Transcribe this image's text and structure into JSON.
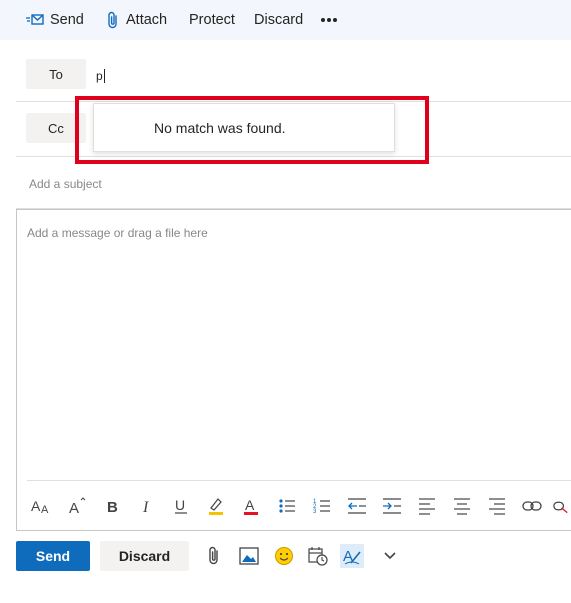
{
  "toolbar": {
    "send_label": "Send",
    "attach_label": "Attach",
    "protect_label": "Protect",
    "discard_label": "Discard",
    "more_icon": "more-icon"
  },
  "recipients": {
    "to_label": "To",
    "to_value": "p",
    "cc_label": "Cc"
  },
  "suggestion": {
    "message": "No match was found."
  },
  "subject": {
    "placeholder": "Add a subject"
  },
  "body": {
    "placeholder": "Add a message or drag a file here"
  },
  "format_icons": [
    "font-size-icon",
    "increase-font-icon",
    "bold-icon",
    "italic-icon",
    "underline-icon",
    "highlight-icon",
    "font-color-icon",
    "bullets-icon",
    "numbering-icon",
    "decrease-indent-icon",
    "increase-indent-icon",
    "align-left-icon",
    "align-center-icon",
    "align-right-icon",
    "link-icon",
    "remove-link-icon"
  ],
  "footer": {
    "send_label": "Send",
    "discard_label": "Discard",
    "icons": [
      "attach-icon",
      "image-icon",
      "emoji-icon",
      "schedule-icon",
      "editor-icon",
      "chevron-down-icon"
    ]
  },
  "colors": {
    "accent": "#0f6cbd",
    "highlight_box": "#e0001b",
    "command_bar": "#f3f6fc"
  }
}
